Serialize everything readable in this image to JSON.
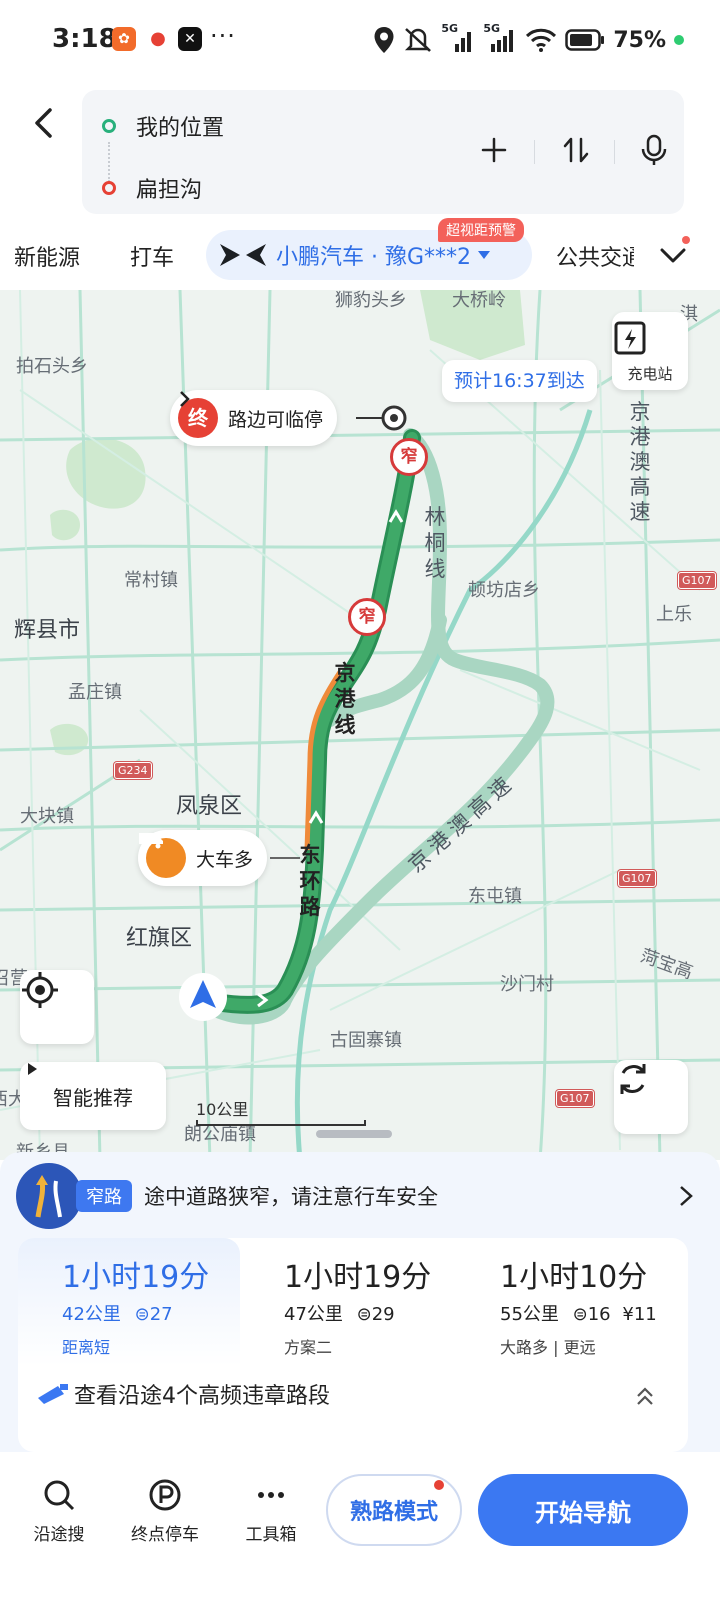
{
  "status_bar": {
    "time": "3:18",
    "dots": "···",
    "signal_label_1": "5G",
    "signal_label_2": "5G",
    "battery_text": "75%"
  },
  "header": {
    "origin": "我的位置",
    "destination": "扁担沟"
  },
  "tabs": {
    "items": [
      "新能源",
      "打车"
    ],
    "car_label": "小鹏汽车 · 豫G***2",
    "car_badge": "超视距预警",
    "public_transit": "公共交通"
  },
  "map": {
    "eta": "预计16:37到达",
    "end_marker": "终",
    "end_label": "路边可临停",
    "charging_station": "充电站",
    "truck_label": "大车多",
    "smart_recommend": "智能推荐",
    "scale_label": "10公里",
    "narrow_badge": "窄",
    "places": {
      "pai_shi_tou": "拍石头乡",
      "shi_bao_tou": "狮豹头乡",
      "da_qiao_ling": "大桥岭",
      "qi_edge": "淇",
      "chang_cun": "常村镇",
      "hui_xian": "辉县市",
      "meng_zhuang": "孟庄镇",
      "feng_quan": "凤泉区",
      "da_kuai": "大块镇",
      "hong_qi": "红旗区",
      "dun_fang": "顿坊店乡",
      "shang_le": "上乐",
      "dong_tun": "东屯镇",
      "sha_men": "沙门村",
      "gu_gu_zhai": "古固寨镇",
      "lang_gong_miao": "朗公庙镇",
      "xin_xiang": "新乡县",
      "zhao_ying_edge": "召营",
      "left_edge": "西大",
      "he_bao_edge": "菏宝高"
    },
    "roads": {
      "lin_tong": "林桐线",
      "jing_gang_xian": "京港线",
      "dong_huan": "东环路",
      "jing_gang_ao": "京港澳高速",
      "jing_gang_ao_diag": "京港澳高速"
    },
    "shields": [
      "G107",
      "G234",
      "G107",
      "G107"
    ]
  },
  "sheet": {
    "alert_tag": "窄路",
    "alert_text": "途中道路狭窄，请注意行车安全",
    "routes": [
      {
        "time": "1小时19分",
        "distance": "42公里",
        "lights": "27",
        "toll": "",
        "tag": "距离短"
      },
      {
        "time": "1小时19分",
        "distance": "47公里",
        "lights": "29",
        "toll": "",
        "tag": "方案二"
      },
      {
        "time": "1小时10分",
        "distance": "55公里",
        "lights": "16",
        "toll": "¥11",
        "tag": "大路多 | 更远"
      }
    ],
    "violation_text": "查看沿途4个高频违章路段"
  },
  "bottom_bar": {
    "search_along": "沿途搜",
    "parking": "终点停车",
    "toolbox": "工具箱",
    "familiar_mode": "熟路模式",
    "start_nav": "开始导航"
  },
  "colors": {
    "accent": "#3b78f2",
    "route_green": "#3fa968",
    "route_alt": "#9ccfb6",
    "alert_red": "#e64135"
  }
}
